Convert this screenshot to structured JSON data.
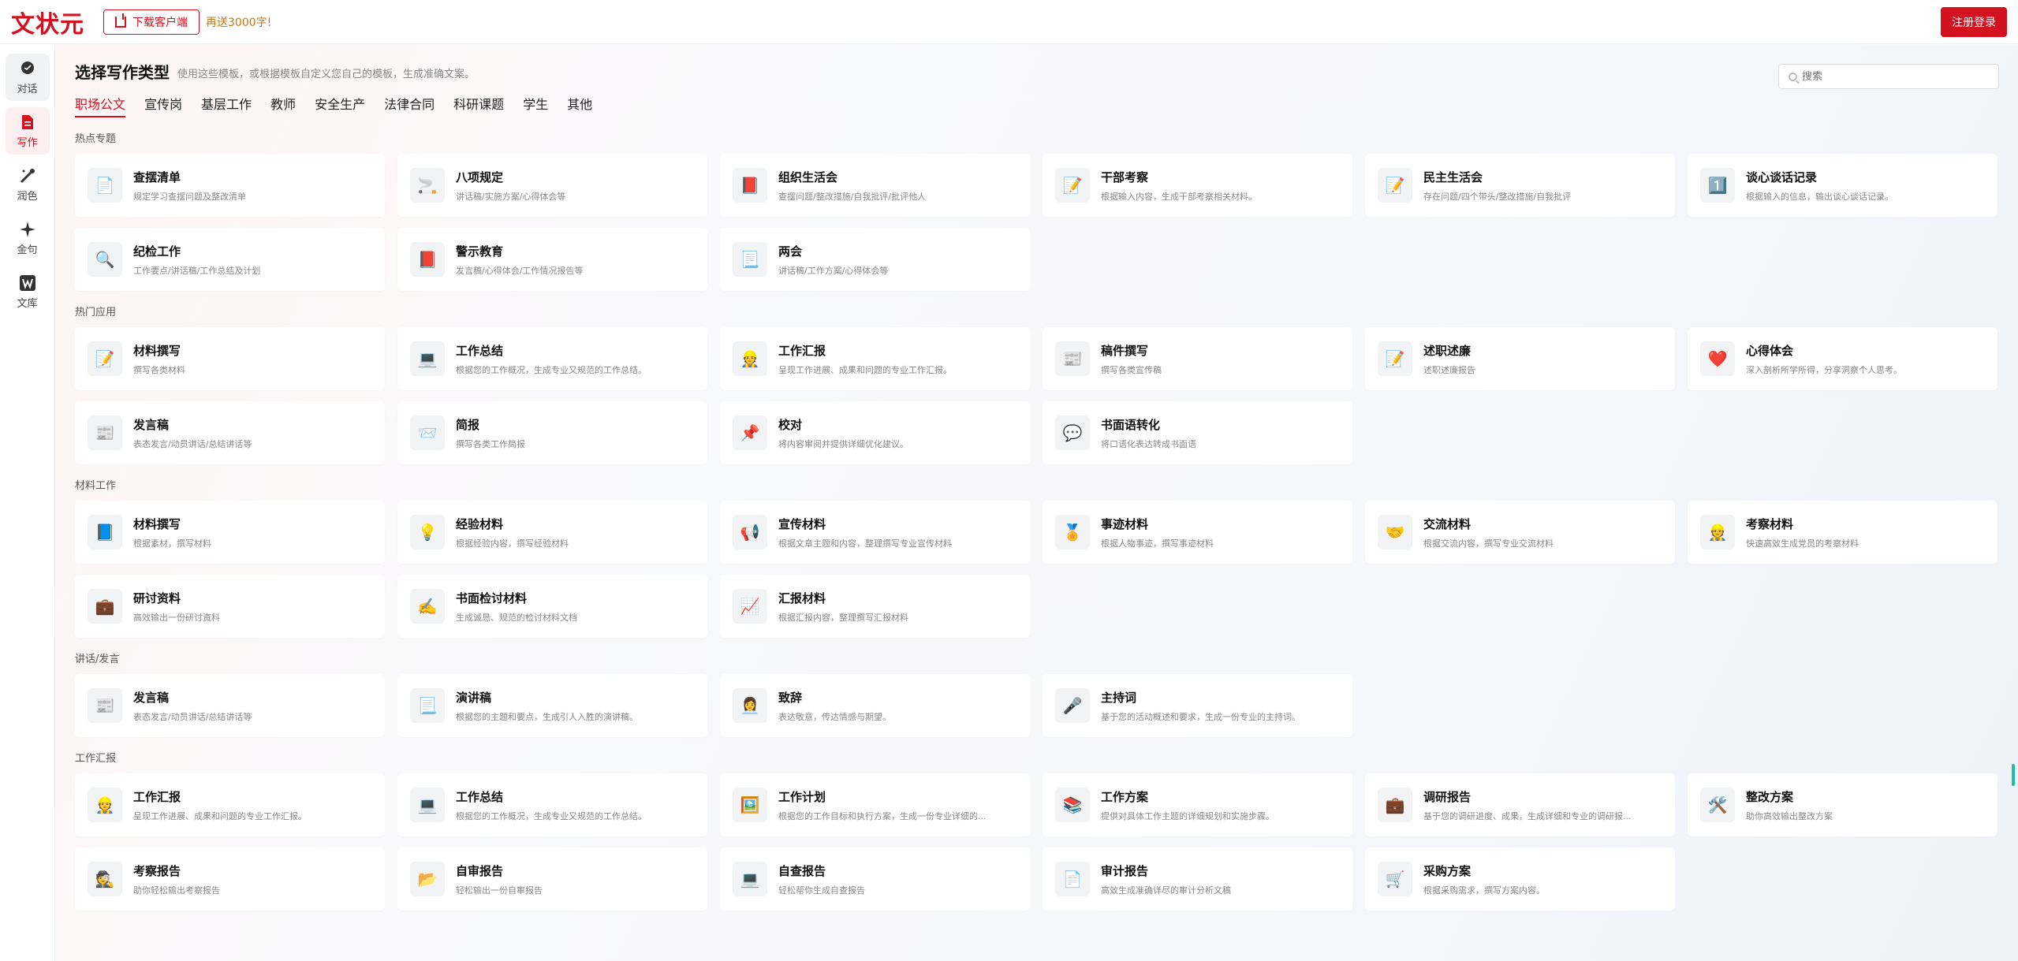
{
  "app": {
    "logo": "文状元",
    "download_label": "下载客户端",
    "promo": "再送3000字!",
    "login_label": "注册登录"
  },
  "sidebar": {
    "items": [
      {
        "label": "对话",
        "icon": "chat-icon"
      },
      {
        "label": "写作",
        "icon": "document-icon"
      },
      {
        "label": "润色",
        "icon": "magic-wand-icon"
      },
      {
        "label": "金句",
        "icon": "sparkle-icon"
      },
      {
        "label": "文库",
        "icon": "library-icon"
      }
    ],
    "active": "写作"
  },
  "header": {
    "title": "选择写作类型",
    "subtitle": "使用这些模板，或根据模板自定义您自己的模板，生成准确文案。",
    "search_placeholder": "搜索"
  },
  "tabs": [
    {
      "label": "职场公文",
      "active": true
    },
    {
      "label": "宣传岗",
      "active": false
    },
    {
      "label": "基层工作",
      "active": false
    },
    {
      "label": "教师",
      "active": false
    },
    {
      "label": "安全生产",
      "active": false
    },
    {
      "label": "法律合同",
      "active": false
    },
    {
      "label": "科研课题",
      "active": false
    },
    {
      "label": "学生",
      "active": false
    },
    {
      "label": "其他",
      "active": false
    }
  ],
  "sections": [
    {
      "title": "热点专题",
      "cards": [
        {
          "icon": "📄",
          "title": "查摆清单",
          "desc": "规定学习查摆问题及整改清单"
        },
        {
          "icon": "🚬",
          "title": "八项规定",
          "desc": "讲话稿/实施方案/心得体会等"
        },
        {
          "icon": "📕",
          "title": "组织生活会",
          "desc": "查摆问题/整改措施/自我批评/批评他人"
        },
        {
          "icon": "📝",
          "title": "干部考察",
          "desc": "根据输入内容，生成干部考察相关材料。"
        },
        {
          "icon": "📝",
          "title": "民主生活会",
          "desc": "存在问题/四个带头/整改措施/自我批评"
        },
        {
          "icon": "1️⃣",
          "title": "谈心谈话记录",
          "desc": "根据输入的信息，输出谈心谈话记录。"
        },
        {
          "icon": "🔍",
          "title": "纪检工作",
          "desc": "工作要点/讲话稿/工作总结及计划"
        },
        {
          "icon": "📕",
          "title": "警示教育",
          "desc": "发言稿/心得体会/工作情况报告等"
        },
        {
          "icon": "📃",
          "title": "两会",
          "desc": "讲话稿/工作方案/心得体会等"
        }
      ]
    },
    {
      "title": "热门应用",
      "cards": [
        {
          "icon": "📝",
          "title": "材料撰写",
          "desc": "撰写各类材料"
        },
        {
          "icon": "💻",
          "title": "工作总结",
          "desc": "根据您的工作概况，生成专业又规范的工作总结。"
        },
        {
          "icon": "👷",
          "title": "工作汇报",
          "desc": "呈现工作进展、成果和问题的专业工作汇报。"
        },
        {
          "icon": "📰",
          "title": "稿件撰写",
          "desc": "撰写各类宣传稿"
        },
        {
          "icon": "📝",
          "title": "述职述廉",
          "desc": "述职述廉报告"
        },
        {
          "icon": "❤️",
          "title": "心得体会",
          "desc": "深入剖析所学所得，分享洞察个人思考。"
        },
        {
          "icon": "📰",
          "title": "发言稿",
          "desc": "表态发言/动员讲话/总结讲话等"
        },
        {
          "icon": "📨",
          "title": "简报",
          "desc": "撰写各类工作简报"
        },
        {
          "icon": "📌",
          "title": "校对",
          "desc": "将内容审阅并提供详细优化建议。"
        },
        {
          "icon": "💬",
          "title": "书面语转化",
          "desc": "将口语化表达转成书面语"
        }
      ]
    },
    {
      "title": "材料工作",
      "cards": [
        {
          "icon": "📘",
          "title": "材料撰写",
          "desc": "根据素材，撰写材料"
        },
        {
          "icon": "💡",
          "title": "经验材料",
          "desc": "根据经验内容，撰写经验材料"
        },
        {
          "icon": "📢",
          "title": "宣传材料",
          "desc": "根据文章主题和内容，整理撰写专业宣传材料"
        },
        {
          "icon": "🏅",
          "title": "事迹材料",
          "desc": "根据人物事迹，撰写事迹材料"
        },
        {
          "icon": "🤝",
          "title": "交流材料",
          "desc": "根据交流内容，撰写专业交流材料"
        },
        {
          "icon": "👷",
          "title": "考察材料",
          "desc": "快速高效生成党员的考察材料"
        },
        {
          "icon": "💼",
          "title": "研讨资料",
          "desc": "高效输出一份研讨资料"
        },
        {
          "icon": "✍️",
          "title": "书面检讨材料",
          "desc": "生成诚恳、规范的检讨材料文档"
        },
        {
          "icon": "📈",
          "title": "汇报材料",
          "desc": "根据汇报内容，整理撰写汇报材料"
        }
      ]
    },
    {
      "title": "讲话/发言",
      "cards": [
        {
          "icon": "📰",
          "title": "发言稿",
          "desc": "表态发言/动员讲话/总结讲话等"
        },
        {
          "icon": "📃",
          "title": "演讲稿",
          "desc": "根据您的主题和要点，生成引人入胜的演讲稿。"
        },
        {
          "icon": "👩‍💼",
          "title": "致辞",
          "desc": "表达敬意，传达情感与期望。"
        },
        {
          "icon": "🎤",
          "title": "主持词",
          "desc": "基于您的活动概述和要求，生成一份专业的主持词。"
        }
      ]
    },
    {
      "title": "工作汇报",
      "cards": [
        {
          "icon": "👷",
          "title": "工作汇报",
          "desc": "呈现工作进展、成果和问题的专业工作汇报。"
        },
        {
          "icon": "💻",
          "title": "工作总结",
          "desc": "根据您的工作概况，生成专业又规范的工作总结。"
        },
        {
          "icon": "🖼️",
          "title": "工作计划",
          "desc": "根据您的工作目标和执行方案，生成一份专业详细的..."
        },
        {
          "icon": "📚",
          "title": "工作方案",
          "desc": "提供对具体工作主题的详细规划和实施步骤。"
        },
        {
          "icon": "💼",
          "title": "调研报告",
          "desc": "基于您的调研进度、成果，生成详细和专业的调研报..."
        },
        {
          "icon": "🛠️",
          "title": "整改方案",
          "desc": "助你高效输出整改方案"
        },
        {
          "icon": "🕵️",
          "title": "考察报告",
          "desc": "助你轻松输出考察报告"
        },
        {
          "icon": "📂",
          "title": "自审报告",
          "desc": "轻松输出一份自审报告"
        },
        {
          "icon": "💻",
          "title": "自查报告",
          "desc": "轻松帮你生成自查报告"
        },
        {
          "icon": "📄",
          "title": "审计报告",
          "desc": "高效生成准确详尽的审计分析文稿"
        },
        {
          "icon": "🛒",
          "title": "采购方案",
          "desc": "根据采购需求，撰写方案内容。"
        }
      ]
    }
  ]
}
